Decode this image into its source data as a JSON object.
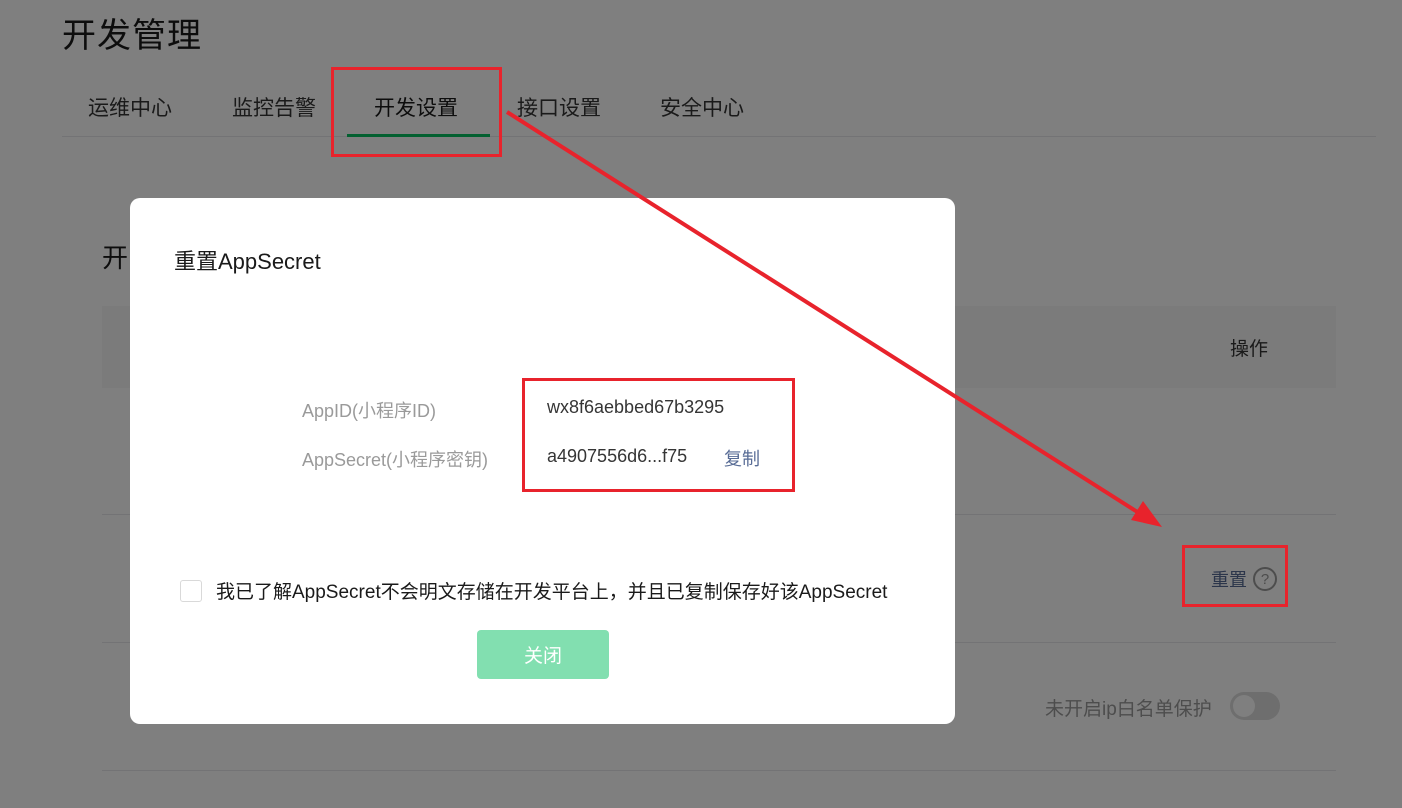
{
  "page": {
    "title": "开发管理",
    "tabs": [
      {
        "label": "运维中心"
      },
      {
        "label": "监控告警"
      },
      {
        "label": "开发设置"
      },
      {
        "label": "接口设置"
      },
      {
        "label": "安全中心"
      }
    ],
    "active_tab": "开发设置",
    "accent_color": "#07c160"
  },
  "card": {
    "title": "开",
    "table_header_op": "操作",
    "reset_label": "重置",
    "help_icon_glyph": "?",
    "ip_whitelist_label": "未开启ip白名单保护",
    "ip_whitelist_enabled": false
  },
  "dialog": {
    "title": "重置AppSecret",
    "appid_label": "AppID(小程序ID)",
    "appid_value": "wx8f6aebbed67b3295",
    "secret_label": "AppSecret(小程序密钥)",
    "secret_value": "a4907556d6...f75",
    "copy_label": "复制",
    "confirm_text": "我已了解AppSecret不会明文存储在开发平台上，并且已复制保存好该AppSecret",
    "confirm_checked": false,
    "close_label": "关闭",
    "close_button_color": "#82dfb0"
  },
  "annotation": {
    "color": "#e8232c"
  }
}
